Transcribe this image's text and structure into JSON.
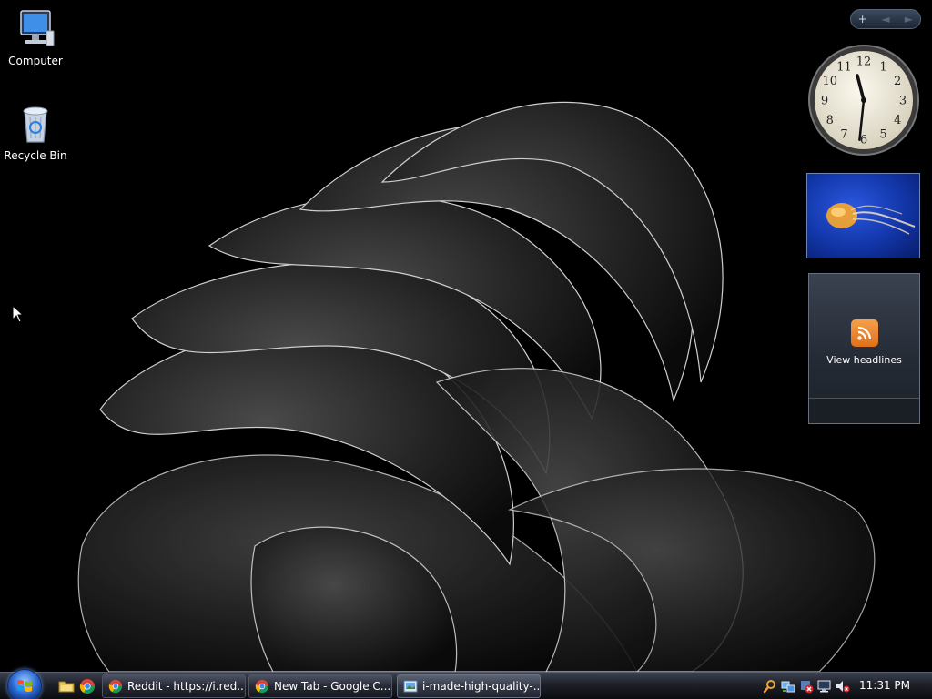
{
  "desktop": {
    "icons": [
      {
        "label": "Computer",
        "icon": "computer-icon"
      },
      {
        "label": "Recycle Bin",
        "icon": "recycle-bin-icon"
      }
    ]
  },
  "sidebar": {
    "controls": {
      "add": "+",
      "prev": "◄",
      "next": "►"
    },
    "clock": {
      "hour": 11,
      "minute": 31
    },
    "feed": {
      "label": "View headlines",
      "icon": "rss-icon"
    },
    "slideshow": {
      "icon": "jellyfish-photo"
    }
  },
  "taskbar": {
    "quick_launch": [
      {
        "icon": "explorer-icon"
      },
      {
        "icon": "chrome-icon"
      }
    ],
    "tasks": [
      {
        "label": "Reddit - https://i.red...",
        "icon": "chrome-icon"
      },
      {
        "label": "New Tab - Google C...",
        "icon": "chrome-icon"
      },
      {
        "label": "i-made-high-quality-...",
        "icon": "image-viewer-icon"
      }
    ],
    "tray": {
      "icons": [
        "search-icon",
        "network-icon",
        "security-alert-icon",
        "display-icon",
        "volume-muted-icon"
      ],
      "time": "11:31 PM"
    }
  },
  "colors": {
    "accent": "#2d6bd6",
    "taskbar": "#1d2028",
    "rss": "#e0701a"
  }
}
